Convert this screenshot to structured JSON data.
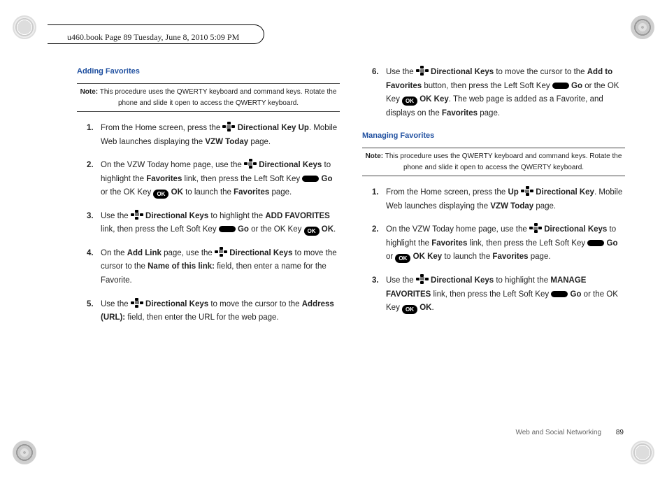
{
  "header": "u460.book  Page 89  Tuesday, June 8, 2010  5:09 PM",
  "left": {
    "title": "Adding Favorites",
    "note_label": "Note:",
    "note_text": "This procedure uses the QWERTY keyboard and command keys. Rotate the phone and slide it open to access the QWERTY keyboard.",
    "steps": {
      "s1": {
        "num": "1.",
        "a": "From the Home screen, press the ",
        "b": "Directional Key Up",
        "c": ". Mobile Web launches displaying the ",
        "d": "VZW Today",
        "e": " page."
      },
      "s2": {
        "num": "2.",
        "a": "On the VZW Today home page, use the ",
        "b": "Directional Keys",
        "c": " to highlight the ",
        "d": "Favorites",
        "e": " link, then press the Left Soft Key ",
        "f": "Go",
        "g": " or the OK Key ",
        "h": "OK",
        "i": " to launch the ",
        "j": "Favorites",
        "k": " page."
      },
      "s3": {
        "num": "3.",
        "a": "Use the ",
        "b": "Directional Keys",
        "c": " to highlight the ",
        "d": "ADD FAVORITES",
        "e": " link, then press the Left Soft Key ",
        "f": "Go",
        "g": " or the OK Key ",
        "h": "OK",
        "i": "."
      },
      "s4": {
        "num": "4.",
        "a": "On the ",
        "b": "Add Link",
        "c": " page, use the ",
        "d": "Directional Keys",
        "e": " to move the cursor to the ",
        "f": "Name of this link:",
        "g": " field, then enter a name for the Favorite."
      },
      "s5": {
        "num": "5.",
        "a": "Use the ",
        "b": "Directional Keys",
        "c": " to move the cursor to the ",
        "d": "Address (URL):",
        "e": " field, then enter the URL for the web page."
      }
    }
  },
  "right": {
    "s6": {
      "num": "6.",
      "a": "Use the ",
      "b": "Directional Keys",
      "c": " to move the cursor to the ",
      "d": "Add to Favorites",
      "e": " button, then press the Left Soft Key ",
      "f": "Go",
      "g": " or the OK Key ",
      "h": "OK Key",
      "i": ". The web page is added as a Favorite, and displays on the ",
      "j": "Favorites",
      "k": " page."
    },
    "title": "Managing Favorites",
    "note_label": "Note:",
    "note_text": "This procedure uses the QWERTY keyboard and command keys. Rotate the phone and slide it open to access the QWERTY keyboard.",
    "steps": {
      "s1": {
        "num": "1.",
        "a": "From the Home screen, press the ",
        "b": "Up",
        "sp": " ",
        "c": "Directional Key",
        "d": ". Mobile Web launches displaying the ",
        "e": "VZW Today",
        "f": " page."
      },
      "s2": {
        "num": "2.",
        "a": "On the VZW Today home page, use the ",
        "b": "Directional Keys",
        "c": " to highlight the ",
        "d": "Favorites",
        "e": " link, then press the Left Soft Key ",
        "f": "Go",
        "g": " or ",
        "h": "OK Key",
        "i": " to launch the ",
        "j": "Favorites",
        "k": " page."
      },
      "s3": {
        "num": "3.",
        "a": "Use the ",
        "b": "Directional Keys",
        "c": " to highlight the ",
        "d": "MANAGE FAVORITES",
        "e": " link, then press the Left Soft Key ",
        "f": "Go",
        "g": " or the OK Key ",
        "h": "OK",
        "i": "."
      }
    }
  },
  "footer": {
    "section": "Web and Social Networking",
    "page": "89"
  },
  "ok_glyph": "OK"
}
